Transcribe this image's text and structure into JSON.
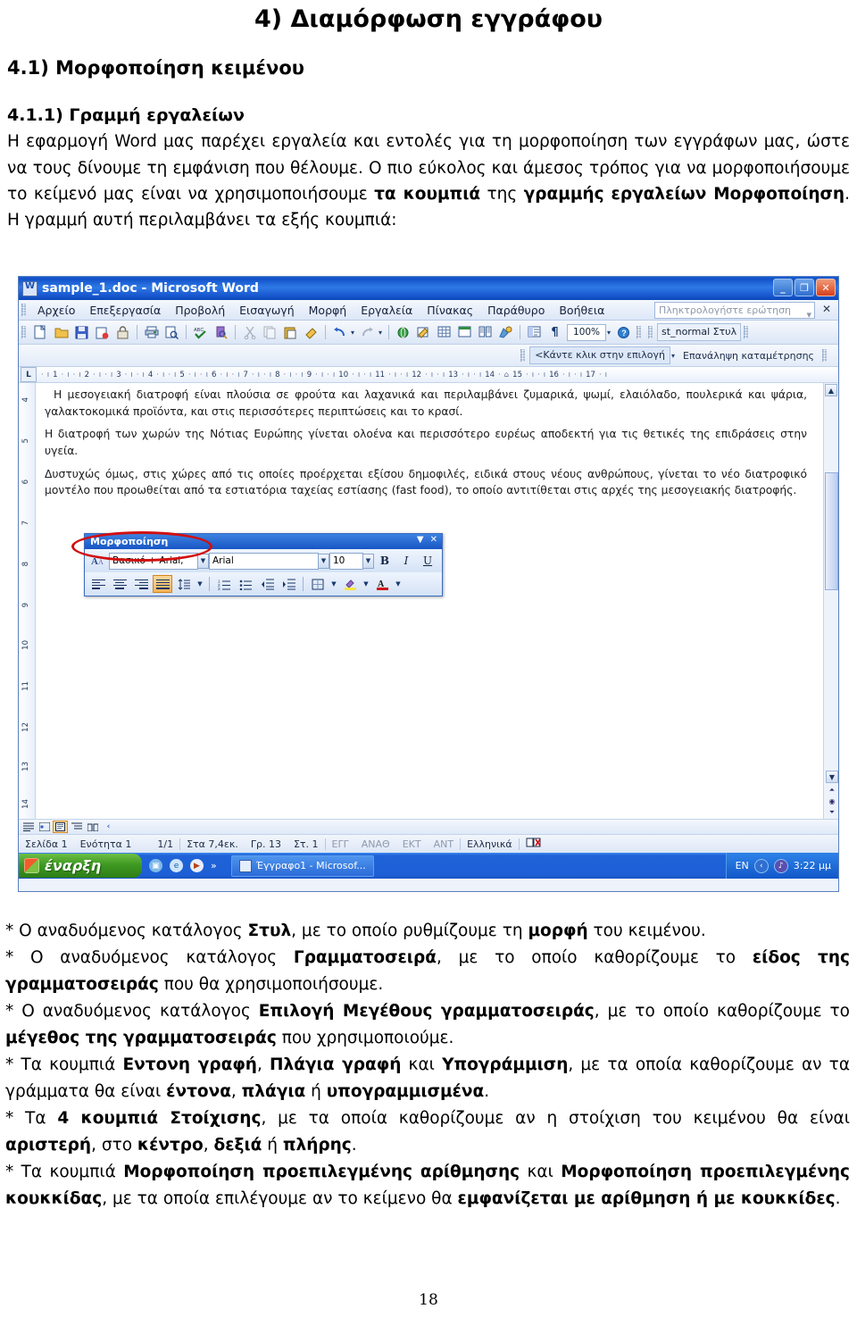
{
  "document": {
    "title": "4) Διαμόρφωση εγγράφου",
    "h2": "4.1) Μορφοποίηση κειμένου",
    "h3": "4.1.1) Γραμμή εργαλείων",
    "intro_part1": "Η εφαρμογή Word μας παρέχει εργαλεία και εντολές για τη μορφοποίηση των εγγράφων μας, ώστε να τους δίνουμε τη εμφάνιση που θέλουμε. Ο πιο εύκολος και άμεσος τρόπος για να μορφοποιήσουμε το κείμενό μας είναι να χρησιμοποιήσουμε ",
    "intro_b1": "τα κουμπιά",
    "intro_part2": " της ",
    "intro_b2": "γραμμής εργαλείων Μορφοποίηση",
    "intro_part3": ". Η γραμμή αυτή περιλαμβάνει τα εξής κουμπιά:",
    "page_number": "18"
  },
  "bullets": [
    {
      "segments": [
        {
          "t": "* Ο αναδυόμενος κατάλογος ",
          "b": false
        },
        {
          "t": "Στυλ",
          "b": true
        },
        {
          "t": ", με το οποίο ρυθμίζουμε τη ",
          "b": false
        },
        {
          "t": "μορφή",
          "b": true
        },
        {
          "t": " του κειμένου.",
          "b": false
        }
      ]
    },
    {
      "segments": [
        {
          "t": "* Ο αναδυόμενος κατάλογος ",
          "b": false
        },
        {
          "t": "Γραμματοσειρά",
          "b": true
        },
        {
          "t": ", με το οποίο καθορίζουμε το ",
          "b": false
        },
        {
          "t": "είδος της γραμματοσειράς",
          "b": true
        },
        {
          "t": " που θα χρησιμοποιήσουμε.",
          "b": false
        }
      ]
    },
    {
      "segments": [
        {
          "t": "* Ο αναδυόμενος κατάλογος ",
          "b": false
        },
        {
          "t": "Επιλογή Μεγέθους γραμματοσειράς",
          "b": true
        },
        {
          "t": ", με το οποίο καθορίζουμε το ",
          "b": false
        },
        {
          "t": "μέγεθος της γραμματοσειράς",
          "b": true
        },
        {
          "t": " που χρησιμοποιούμε.",
          "b": false
        }
      ]
    },
    {
      "segments": [
        {
          "t": "* Τα κουμπιά ",
          "b": false
        },
        {
          "t": "Εντονη γραφή",
          "b": true
        },
        {
          "t": ", ",
          "b": false
        },
        {
          "t": "Πλάγια γραφή",
          "b": true
        },
        {
          "t": " και ",
          "b": false
        },
        {
          "t": "Υπογράμμιση",
          "b": true
        },
        {
          "t": ", με τα οποία καθορίζουμε αν τα γράμματα θα είναι ",
          "b": false
        },
        {
          "t": "έντονα",
          "b": true
        },
        {
          "t": ", ",
          "b": false
        },
        {
          "t": "πλάγια",
          "b": true
        },
        {
          "t": " ή ",
          "b": false
        },
        {
          "t": "υπογραμμισμένα",
          "b": true
        },
        {
          "t": ".",
          "b": false
        }
      ]
    },
    {
      "segments": [
        {
          "t": "* Τα ",
          "b": false
        },
        {
          "t": "4 κουμπιά Στοίχισης",
          "b": true
        },
        {
          "t": ", με τα οποία καθορίζουμε αν η στοίχιση του κειμένου θα είναι ",
          "b": false
        },
        {
          "t": "αριστερή",
          "b": true
        },
        {
          "t": ", στο ",
          "b": false
        },
        {
          "t": "κέντρο",
          "b": true
        },
        {
          "t": ", ",
          "b": false
        },
        {
          "t": "δεξιά",
          "b": true
        },
        {
          "t": " ή ",
          "b": false
        },
        {
          "t": "πλήρης",
          "b": true
        },
        {
          "t": ".",
          "b": false
        }
      ]
    },
    {
      "segments": [
        {
          "t": "* Τα κουμπιά ",
          "b": false
        },
        {
          "t": "Μορφοποίηση προεπιλεγμένης αρίθμησης",
          "b": true
        },
        {
          "t": " και ",
          "b": false
        },
        {
          "t": "Μορφοποίηση προεπιλεγμένης κουκκίδας",
          "b": true
        },
        {
          "t": ", με τα οποία επιλέγουμε αν το κείμενο θα ",
          "b": false
        },
        {
          "t": "εμφανίζεται με αρίθμηση ή με κουκκίδες",
          "b": true
        },
        {
          "t": ".",
          "b": false
        }
      ]
    }
  ],
  "word": {
    "titlebar": {
      "text": "sample_1.doc - Microsoft Word",
      "minimize": "_",
      "restore": "❐",
      "close": "✕"
    },
    "menus": [
      "Αρχείο",
      "Επεξεργασία",
      "Προβολή",
      "Εισαγωγή",
      "Μορφή",
      "Εργαλεία",
      "Πίνακας",
      "Παράθυρο",
      "Βοήθεια"
    ],
    "ask_question_placeholder": "Πληκτρολογήστε ερώτηση",
    "menu_close": "✕",
    "toolbar_icons": [
      "new-document",
      "open-folder",
      "save-disk",
      "mail-recipient",
      "permission-lock",
      "print",
      "print-preview",
      "spelling-check",
      "research",
      "cut-scissors",
      "copy",
      "paste",
      "format-painter",
      "undo",
      "redo"
    ],
    "toolbar_icons2": [
      "insert-hyperlink",
      "tables-and-borders",
      "insert-table",
      "insert-excel-sheet",
      "columns",
      "drawing",
      "document-map",
      "show-formatting"
    ],
    "zoom_value": "100%",
    "help_icon": "help-question",
    "style_box_text": "st_normal Στυλ",
    "toolbar2": {
      "field": "<Κάντε κλικ στην επιλογή",
      "label": "Επανάληψη καταμέτρησης"
    },
    "ruler": {
      "tab_selector": "L",
      "numbers": [
        "1",
        "2",
        "3",
        "4",
        "5",
        "6",
        "7",
        "8",
        "9",
        "10",
        "11",
        "12",
        "13",
        "14",
        "15",
        "16",
        "17"
      ]
    },
    "vruler_numbers": [
      "4",
      "5",
      "6",
      "7",
      "8",
      "9",
      "10",
      "11",
      "12",
      "13",
      "14"
    ],
    "doc_paragraphs": [
      "Η μεσογειακή διατροφή είναι πλούσια σε φρούτα και λαχανικά και περιλαμβάνει ζυμαρικά, ψωμί, ελαιόλαδο, πουλερικά και ψάρια, γαλακτοκομικά προϊόντα, και στις περισσότερες περιπτώσεις και το κρασί.",
      "Η διατροφή των χωρών της Νότιας Ευρώπης γίνεται ολοένα και περισσότερο ευρέως αποδεκτή για τις θετικές της επιδράσεις στην υγεία.",
      "Δυστυχώς όμως, στις χώρες από τις οποίες προέρχεται εξίσου δημοφιλές, ειδικά στους νέους ανθρώπους, γίνεται το νέο διατροφικό μοντέλο που προωθείται από τα εστιατόρια ταχείας εστίασης (fast food), το οποίο αντιτίθεται στις αρχές της μεσογειακής διατροφής."
    ],
    "floating_toolbar": {
      "title": "Μορφοποίηση",
      "dropdown_icon": "▼",
      "close_icon": "✕",
      "style_value": "Βασικό + Arial,",
      "font_value": "Arial",
      "size_value": "10",
      "bold_label": "B",
      "italic_label": "I",
      "underline_label": "U",
      "buttons_row2": [
        "align-left",
        "align-center",
        "align-right",
        "align-justify",
        "line-spacing",
        "numbered-list",
        "bulleted-list",
        "decrease-indent",
        "increase-indent",
        "borders",
        "highlight-color",
        "font-color"
      ]
    },
    "statusbar": {
      "page": "Σελίδα 1",
      "section": "Ενότητα 1",
      "pages": "1/1",
      "at": "Στα 7,4εκ.",
      "line": "Γρ. 13",
      "col": "Στ. 1",
      "flags": [
        "ΕΓΓ",
        "ΑΝΑΘ",
        "ΕΚΤ",
        "ΑΝΤ"
      ],
      "language": "Ελληνικά",
      "spell_icon": "spell-check-status"
    },
    "view_buttons": [
      "normal-view",
      "web-layout-view",
      "print-layout-view",
      "outline-view",
      "reading-view",
      "back-arrow"
    ]
  },
  "taskbar": {
    "start_label": "έναρξη",
    "quicklaunch": [
      "show-desktop",
      "internet-explorer",
      "media-player",
      "more-chevron"
    ],
    "task_label": "Έγγραφο1 - Microsof...",
    "tray_lang": "EN",
    "tray_icons": [
      "volume-icon",
      "network-icon"
    ],
    "clock": "3:22 μμ"
  },
  "colors": {
    "titlebar_blue": "#1856c5",
    "annotation_red": "#d10f0f",
    "highlight_orange": "#f6b354",
    "start_green": "#3f9a22"
  }
}
